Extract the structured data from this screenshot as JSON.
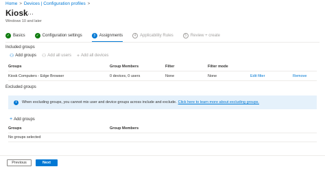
{
  "breadcrumb": {
    "items": [
      "Home",
      "Devices | Configuration profiles"
    ],
    "separator": ">"
  },
  "header": {
    "title": "Kiosk",
    "more": "…",
    "subtitle": "Windows 10 and later"
  },
  "wizard": {
    "steps": [
      {
        "label": "Basics",
        "state": "done",
        "marker": "✓"
      },
      {
        "label": "Configuration settings",
        "state": "done",
        "marker": "✓"
      },
      {
        "label": "Assignments",
        "state": "current",
        "marker": "3"
      },
      {
        "label": "Applicability Rules",
        "state": "future",
        "marker": "4"
      },
      {
        "label": "Review + create",
        "state": "future",
        "marker": "5"
      }
    ]
  },
  "included": {
    "section_label": "Included groups",
    "actions": {
      "add_groups": "Add groups",
      "add_all_users": "Add all users",
      "add_all_devices": "Add all devices"
    },
    "columns": [
      "Groups",
      "Group Members",
      "Filter",
      "Filter mode",
      "",
      ""
    ],
    "rows": [
      {
        "group": "Kiosk Computers - Edge Browser",
        "members": "0 devices, 0 users",
        "filter": "None",
        "filter_mode": "None",
        "edit": "Edit filter",
        "remove": "Remove"
      }
    ]
  },
  "excluded": {
    "section_label": "Excluded groups",
    "info_text": "When excluding groups, you cannot mix user and device groups across include and exclude.",
    "info_link": "Click here to learn more about excluding groups.",
    "add_groups": "Add groups",
    "columns": [
      "Groups",
      "Group Members"
    ],
    "empty_text": "No groups selected"
  },
  "footer": {
    "previous": "Previous",
    "next": "Next"
  },
  "colors": {
    "accent": "#0078d4",
    "success": "#107c10",
    "info_bg": "#e5f1fb"
  }
}
